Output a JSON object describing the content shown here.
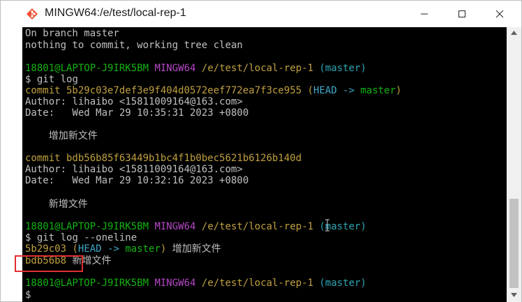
{
  "window": {
    "title": "MINGW64:/e/test/local-rep-1"
  },
  "terminal": {
    "status_line1": "On branch master",
    "status_line2": "nothing to commit, working tree clean",
    "prompt": {
      "user_host": "18801@LAPTOP-J9IRK5BM",
      "shell": "MINGW64",
      "path": "/e/test/local-rep-1",
      "branch": "(master)",
      "symbol": "$"
    },
    "cmd1": "git log",
    "commit1": {
      "hash_line": "commit 5b29c03e7def3e9f404d0572eef772ea7f3ce955",
      "ref_open": "(",
      "head": "HEAD -> ",
      "branch": "master",
      "ref_close": ")",
      "author": "Author: lihaibo <15811009164@163.com>",
      "date": "Date:   Wed Mar 29 10:35:31 2023 +0800",
      "message": "    增加新文件"
    },
    "commit2": {
      "hash_line": "commit bdb56b85f63449b1bc4f1b0bec5621b6126b140d",
      "author": "Author: lihaibo <15811009164@163.com>",
      "date": "Date:   Wed Mar 29 10:32:16 2023 +0800",
      "message": "    新增文件"
    },
    "cmd2": "git log --oneline",
    "oneline1": {
      "short_hash": "5b29c03",
      "ref_open": "(",
      "head": "HEAD -> ",
      "branch": "master",
      "ref_close": ")",
      "message": " 增加新文件"
    },
    "oneline2": {
      "short_hash": "bdb56b8",
      "message": " 新增文件"
    }
  },
  "icons": {
    "app": "git-bash-icon",
    "minimize": "minimize-icon",
    "maximize": "maximize-icon",
    "close": "close-icon"
  }
}
